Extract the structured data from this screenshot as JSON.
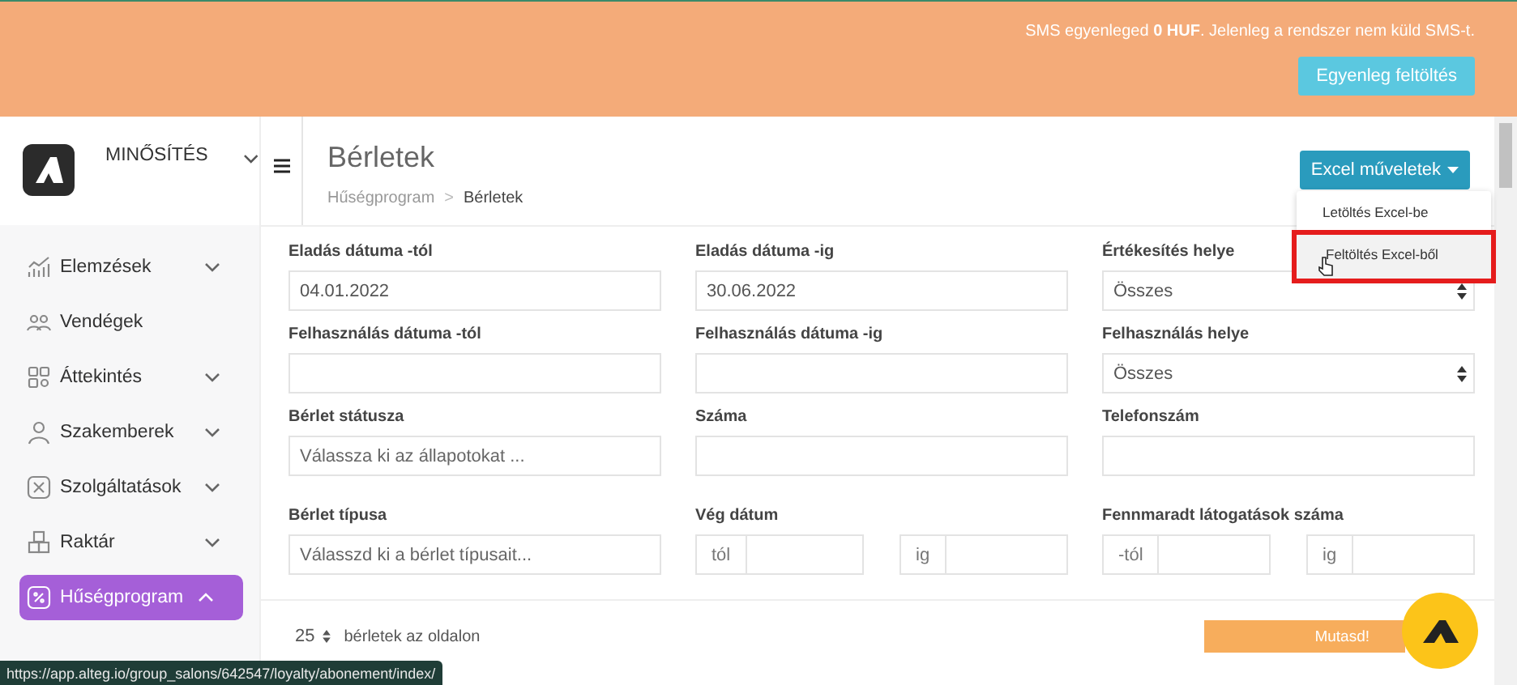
{
  "banner": {
    "message": "SMS egyenleged **0 HUF**. Jelenleg a rendszer nem küld SMS-t.",
    "button": "Egyenleg feltöltés"
  },
  "sidebar": {
    "brand": "MINŐSÍTÉS",
    "items": [
      {
        "label": "Elemzések",
        "expanded": false,
        "selected": false
      },
      {
        "label": "Vendégek",
        "selected": false
      },
      {
        "label": "Áttekintés",
        "expanded": false,
        "selected": false
      },
      {
        "label": "Szakemberek",
        "expanded": false,
        "selected": false
      },
      {
        "label": "Szolgáltatások",
        "expanded": false,
        "selected": false
      },
      {
        "label": "Raktár",
        "expanded": false,
        "selected": false
      },
      {
        "label": "Hűségprogram",
        "expanded": true,
        "selected": true
      }
    ]
  },
  "header": {
    "title": "Bérletek",
    "breadcrumb": [
      "Hűségprogram",
      "Bérletek"
    ],
    "breadcrumb_separator": ">",
    "excel_button": "Excel műveletek",
    "menu": [
      {
        "label": "Letöltés Excel-be",
        "selected": false
      },
      {
        "label": "Feltöltés Excel-ből",
        "selected": true
      }
    ]
  },
  "filters": [
    {
      "label": "Eladás dátuma -tól",
      "kind": "input",
      "value": "04.01.2022"
    },
    {
      "label": "Eladás dátuma -ig",
      "kind": "input",
      "value": "30.06.2022"
    },
    {
      "label": "Értékesítés helye",
      "kind": "select",
      "value": "Összes"
    },
    {
      "label": "Felhasználás dátuma -tól",
      "kind": "input"
    },
    {
      "label": "Felhasználás dátuma -ig",
      "kind": "input"
    },
    {
      "label": "Felhasználás helye",
      "kind": "select",
      "value": "Összes"
    },
    {
      "label": "Bérlet státusza",
      "kind": "input",
      "placeholder": "Válassza ki az állapotokat ..."
    },
    {
      "label": "Száma",
      "kind": "input"
    },
    {
      "label": "Telefonszám",
      "kind": "input"
    },
    {
      "label": "Bérlet típusa",
      "kind": "input",
      "placeholder": "Válasszd ki a bérlet típusait..."
    },
    {
      "label": "Vég dátum",
      "kind": "range",
      "from": "tól",
      "to": "ig"
    },
    {
      "label": "Fennmaradt látogatások száma",
      "kind": "range",
      "from": "-tól",
      "to": "ig"
    }
  ],
  "footer": {
    "per_page": "25",
    "per_page_label": "bérletek az oldalon",
    "show_button": "Mutasd!"
  },
  "status_url": "https://app.alteg.io/group_salons/642547/loyalty/abonement/index/"
}
